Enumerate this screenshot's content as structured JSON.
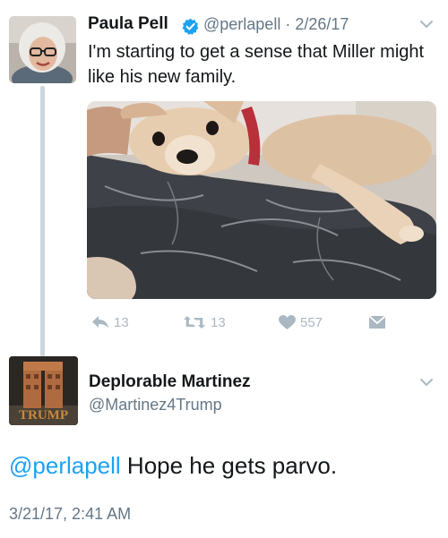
{
  "tweet1": {
    "author_name": "Paula Pell",
    "handle_date": "@perlapell · 2/26/17",
    "text": "I'm starting to get a sense that Miller might like his new family.",
    "actions": {
      "reply_count": "13",
      "retweet_count": "13",
      "like_count": "557"
    }
  },
  "tweet2": {
    "author_name": "Deplorable Martinez",
    "handle": "@Martinez4Trump",
    "avatar_text": "TRUMP",
    "mention": "@perlapell",
    "text": " Hope he gets parvo.",
    "timestamp": "3/21/17, 2:41 AM"
  },
  "icons": {
    "verified": "verified-badge-icon",
    "chevron": "chevron-down-icon",
    "reply": "reply-icon",
    "retweet": "retweet-icon",
    "like": "heart-icon",
    "dm": "direct-message-icon"
  },
  "colors": {
    "link": "#1da1f2",
    "secondary_text": "#657786",
    "action_icon": "#aab8c2",
    "thread_line": "#ccd6dd"
  }
}
